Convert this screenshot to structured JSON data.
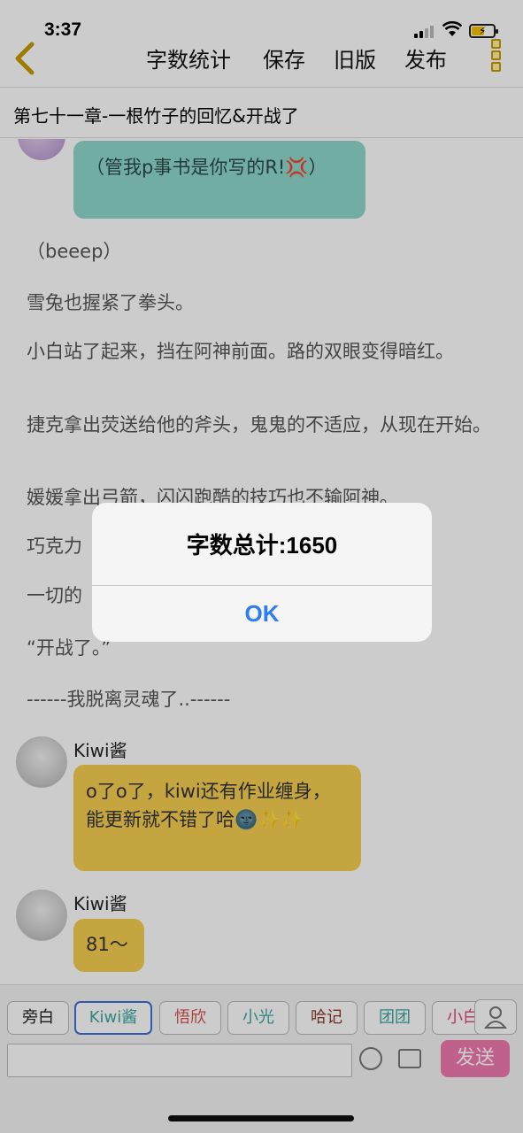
{
  "status": {
    "time": "3:37"
  },
  "nav": {
    "word_count": "字数统计",
    "save": "保存",
    "old_version": "旧版",
    "publish": "发布"
  },
  "chapter": {
    "title": "第七十一章-一根竹子的回忆&开战了"
  },
  "content": {
    "top_bubble": "（管我p事书是你写的R!💢）",
    "paragraphs": [
      "（beeep）",
      "雪兔也握紧了拳头。",
      "小白站了起来，挡在阿神前面。路的双眼变得暗红。",
      "捷克拿出荧送给他的斧头，鬼鬼的不适应，从现在开始。",
      "媛媛拿出弓箭，闪闪跑酷的技巧也不输阿神。",
      "巧克力",
      "一切的",
      "“开战了。”",
      "------我脱离灵魂了..------"
    ],
    "comments": [
      {
        "name": "Kiwi酱",
        "text": "o了o了，kiwi还有作业缠身，能更新就不错了哈🌚✨✨"
      },
      {
        "name": "Kiwi酱",
        "text": "81～"
      }
    ]
  },
  "bottom": {
    "chips": [
      {
        "label": "旁白",
        "color": "#222222"
      },
      {
        "label": "Kiwi酱",
        "color": "#3aa7a0"
      },
      {
        "label": "悟欣",
        "color": "#d9534f"
      },
      {
        "label": "小光",
        "color": "#3aa7a0"
      },
      {
        "label": "哈记",
        "color": "#8a3a2a"
      },
      {
        "label": "团团",
        "color": "#3aa7a0"
      },
      {
        "label": "小白",
        "color": "#e0457b"
      }
    ],
    "send": "发送"
  },
  "dialog": {
    "message": "字数总计:1650",
    "ok": "OK"
  }
}
